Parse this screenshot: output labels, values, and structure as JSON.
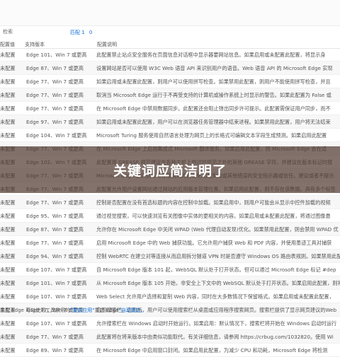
{
  "toolbar": {
    "search_label": "检索",
    "match_count": "匹配 1",
    "match_suffix": "0"
  },
  "table": {
    "headers": [
      "配置值",
      "支持版本",
      "配置说明"
    ],
    "rows": [
      {
        "state": "未配置",
        "version": "Edge 101、Win 7 或更高",
        "desc": "此配置禁止站点安全服务在页面信息对话框中显示器要网站信息。如果启用或未配置此配置，将显示身"
      },
      {
        "state": "未配置",
        "version": "Edge 87、Win 7 或更高",
        "desc": "设置网站是否可以使用 W3C Web 语音 API 来识别用户的语音。Web 语音 API 的 Microsoft Edge 实现"
      },
      {
        "state": "未配置",
        "version": "Edge 77、Win 7 或更高",
        "desc": "如果启用或未配置此配置，则用户可以使用拼写检查。如果禁用此配置，则用户不能使用拼写检查，并且"
      },
      {
        "state": "未配置",
        "version": "Edge 77、Win 7 或更高",
        "desc": "取消当 Microsoft Edge 运行于不再受支持的计算机或操作系统上时显示的警告。如果此配置为 False 或"
      },
      {
        "state": "未配置",
        "version": "Edge 77、Win 7 或更高",
        "desc": "在 Microsoft Edge 中禁用数据同步。此配置还会阻止弹出同步许可提示。此配置需保证用户同步，而不"
      },
      {
        "state": "未配置",
        "version": "Edge 97、Win 7 或更高",
        "desc": "如果启用或未配置此配置，用户可以在浏览器任务管理器中结束进程。如果禁用此配置，用户将无法结束"
      },
      {
        "state": "未配置",
        "version": "Edge 104、Win 7 或更高",
        "desc": "Microsoft Turing 服务使用自然语言处理为网页上的长格式可编辑文本字段生成预测。如果启用此配置"
      },
      {
        "state": "未配置",
        "version": "Edge 77、Win 7 或更高",
        "desc": "在 Microsoft Edge 上启用集成式 Microsoft 翻译服务。如果启用此配置，则 Microsoft Edge 会在适"
      },
      {
        "state": "未配置",
        "version": "Edge 102、Win 7 或更高",
        "desc": "此配置用 GREASE 规范建议在各种主机上的过时规范之外的其他 GREASE 字符，并建议在版本标记时按"
      },
      {
        "state": "未配置",
        "version": "Edge 77、Win 7 或更高",
        "desc": "Microsoft Edge 在识别与现有搜索词的自动化功能失效或其他错误的安全指示器或信任。建议或者不提示"
      },
      {
        "state": "未配置",
        "version": "Edge 77、Win 7 或更高",
        "desc": "此配置允许用户设置网站通过网站的应用版本管理位置。如果启用此配置，则不存在该数据。具有多个标签"
      },
      {
        "state": "未配置",
        "version": "Edge 77、Win 7 或更高",
        "desc": "控制是否配置在没有首选标题的内容在控制中加载。如果启用中，则用户可能会从显示中控件加载的视频"
      },
      {
        "state": "未配置",
        "version": "Edge 95、Win 7 或更高",
        "desc": "通过视觉搜索，可以快速浏览有关图像中实体的更相关的内容。如果启用或未配置此配置，将通过图像悬"
      },
      {
        "state": "未配置",
        "version": "Edge 87、Win 7 或更高",
        "desc": "允许你在 Microsoft Edge 中关闭 WPAD (Web 代理自动发现)优化。如果禁用此配置，则会禁用 WPAD 优"
      },
      {
        "state": "未配置",
        "version": "Edge 77、Win 7 或更高",
        "desc": "启用 Microsoft Edge 中的 Web 捕获功能。它允许用户捕获 Web 和 PDF 内容，并使用墨迹工具对捕获"
      },
      {
        "state": "未配置",
        "version": "Edge 94、Win 7 或更高",
        "desc": "控制 WebRTC 在建立对等连接从而启用拆分隧道 VPN 时是否遵守 Windows OS 路由表规则。如果禁用此配"
      },
      {
        "state": "未配置",
        "version": "Edge 107、Win 7 或更高",
        "desc": "自 Microsoft Edge 版本 101 起，WebSQL 默认处于打开状态。但可以通过 Microsoft Edge 标记 #dep"
      },
      {
        "state": "未配置",
        "version": "Edge 101、Win 7 或更高",
        "desc": "从 Microsoft Edge 版本 105 开始，非安全上下文中的 WebSQL 默认处于打开状态。如果启用此配置，则将"
      },
      {
        "state": "未配置",
        "version": "Edge 107、Win 7 或更高",
        "desc": "Web Select 允许用户选择和复制 Web 内容，同时在大多数情况下保留格式。如果启用或未配置此配置，"
      },
      {
        "state": "未配置",
        "version": "Edge 77、Win 7 或更高",
        "desc": "启用搜索栏。启用后，用户可以使用搜索栏从桌面或应用程序搜索网页。搜索栏提供了显示网页建议的Web"
      },
      {
        "state": "未配置",
        "version": "Edge 107、Win 7 或更高",
        "desc": "允许搜索栏在 Windows 启动时开始运行。如果启用：默认情况下，搜索栏将开始在 Windows 启动时运行"
      },
      {
        "state": "未配置",
        "version": "Edge 77、Win 7 或更高",
        "desc": "此配置将在将来版本中由类似功能取代。有关详细信息，请参阅 https://crbug.com/1032820。使用 Wi"
      },
      {
        "state": "未配置",
        "version": "Edge 89、Win 7 或更高",
        "desc": "在 Microsoft Edge 中启用窗口封闭。如果启用此配置，为减少 CPU 和功耗，Microsoft Edge 将检测"
      }
    ]
  },
  "banner": {
    "text": "关键词应简洁明了"
  },
  "footer": {
    "prefix": "重启 Edge 可以使用工具禁用的",
    "link1": "\"重启应用\"",
    "middle": "重启 Edge",
    "link2": "\"自动重启。"
  }
}
